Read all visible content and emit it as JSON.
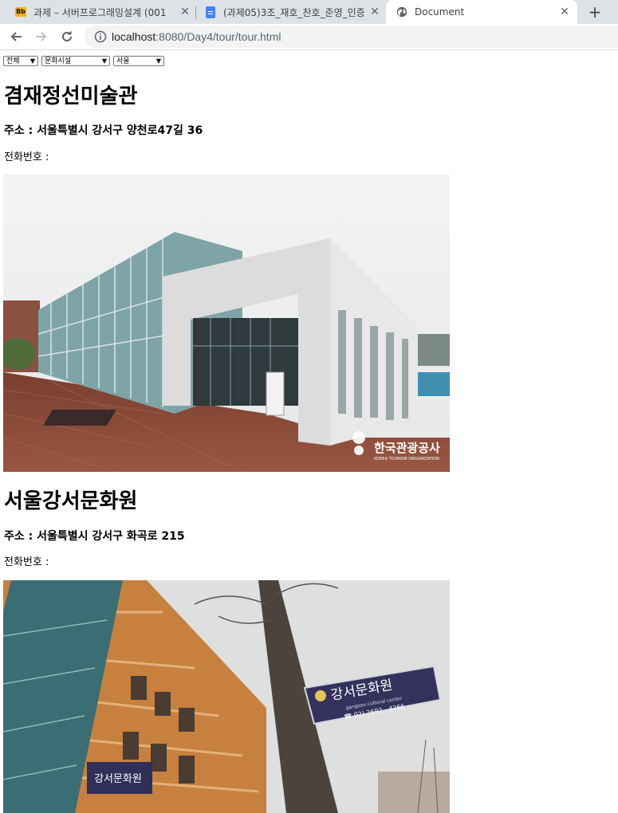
{
  "browser": {
    "tabs": [
      {
        "title": "과제 – 서버프로그래밍설계 (001",
        "favicon": "blackboard-icon",
        "active": false
      },
      {
        "title": "(과제05)3조_재호_찬호_준영_인증",
        "favicon": "google-docs-icon",
        "active": false
      },
      {
        "title": "Document",
        "favicon": "globe-icon",
        "active": true
      }
    ],
    "url_host": "localhost",
    "url_rest": ":8080/Day4/tour/tour.html"
  },
  "filters": {
    "area": "전체",
    "category": "문화시설",
    "city": "서울"
  },
  "places": [
    {
      "name": "겸재정선미술관",
      "address": "주소 : 서울특별시 강서구 양천로47길 36",
      "phone": "전화번호 :",
      "watermark": "한국관광공사",
      "watermark_sub": "KOREA TOURISM ORGANIZATION"
    },
    {
      "name": "서울강서문화원",
      "address": "주소 : 서울특별시 강서구 화곡로 215",
      "phone": "전화번호 :",
      "sign_text": "강서문화원",
      "sign_sub": "gangseo cultural center",
      "sign_phone": "☎ 02) 2692 - 4266"
    }
  ],
  "colors": {
    "tabstrip": "#dee1e6",
    "omnibox": "#f1f3f4"
  }
}
